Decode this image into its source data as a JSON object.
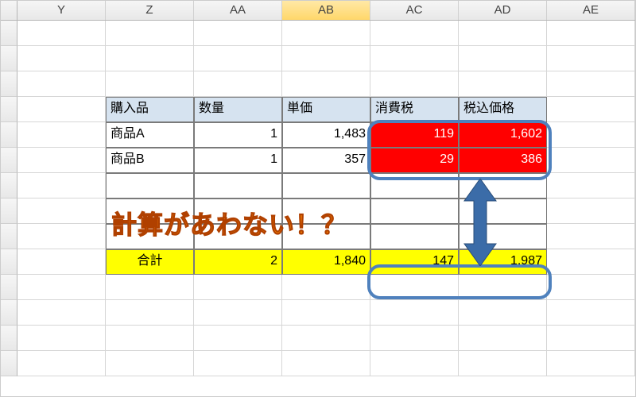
{
  "columns": [
    "Y",
    "Z",
    "AA",
    "AB",
    "AC",
    "AD",
    "AE"
  ],
  "selected_column": "AB",
  "table": {
    "headers": [
      "購入品",
      "数量",
      "単価",
      "消費税",
      "税込価格"
    ],
    "rows": [
      {
        "item": "商品A",
        "qty": "1",
        "unit": "1,483",
        "tax": "119",
        "total": "1,602"
      },
      {
        "item": "商品B",
        "qty": "1",
        "unit": "357",
        "tax": "29",
        "total": "386"
      }
    ],
    "total_row": {
      "label": "合計",
      "qty": "2",
      "unit": "1,840",
      "tax": "147",
      "total": "1,987"
    }
  },
  "callout_text": "計算があわない！？",
  "colors": {
    "header_fill": "#d6e3f0",
    "highlight_red": "#ff0000",
    "highlight_yellow": "#ffff00",
    "ring": "#4f81bd",
    "arrow": "#3b6ca8",
    "callout": "#ff8a00"
  },
  "chart_data": {
    "type": "table",
    "title": "購入品 計算",
    "columns": [
      "購入品",
      "数量",
      "単価",
      "消費税",
      "税込価格"
    ],
    "rows": [
      [
        "商品A",
        1,
        1483,
        119,
        1602
      ],
      [
        "商品B",
        1,
        357,
        29,
        386
      ],
      [
        "合計",
        2,
        1840,
        147,
        1987
      ]
    ],
    "annotation": "計算があわない！？"
  }
}
